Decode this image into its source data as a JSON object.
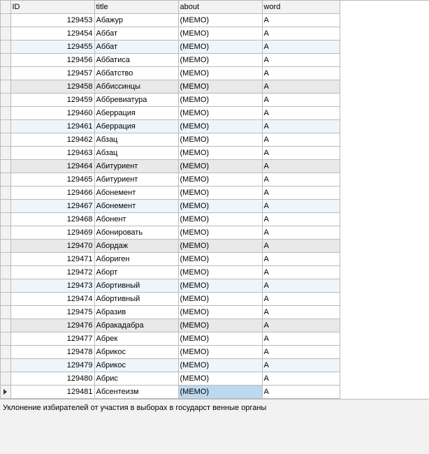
{
  "columns": {
    "id": "ID",
    "title": "title",
    "about": "about",
    "word": "word"
  },
  "rows": [
    {
      "id": "129453",
      "title": "Абажур",
      "about": "(MEMO)",
      "word": "А",
      "hl": ""
    },
    {
      "id": "129454",
      "title": "Аббат",
      "about": "(MEMO)",
      "word": "А",
      "hl": ""
    },
    {
      "id": "129455",
      "title": "Аббат",
      "about": "(MEMO)",
      "word": "А",
      "hl": "lite"
    },
    {
      "id": "129456",
      "title": "Аббатиса",
      "about": "(MEMO)",
      "word": "А",
      "hl": ""
    },
    {
      "id": "129457",
      "title": "Аббатство",
      "about": "(MEMO)",
      "word": "А",
      "hl": ""
    },
    {
      "id": "129458",
      "title": "Аббиссинцы",
      "about": "(MEMO)",
      "word": "А",
      "hl": "dark"
    },
    {
      "id": "129459",
      "title": "Аббревиатура",
      "about": "(MEMO)",
      "word": "А",
      "hl": ""
    },
    {
      "id": "129460",
      "title": "Аберрация",
      "about": "(MEMO)",
      "word": "А",
      "hl": ""
    },
    {
      "id": "129461",
      "title": "Аберрация",
      "about": "(MEMO)",
      "word": "А",
      "hl": "lite"
    },
    {
      "id": "129462",
      "title": "Абзац",
      "about": "(MEMO)",
      "word": "А",
      "hl": ""
    },
    {
      "id": "129463",
      "title": "Абзац",
      "about": "(MEMO)",
      "word": "А",
      "hl": ""
    },
    {
      "id": "129464",
      "title": "Абитуриент",
      "about": "(MEMO)",
      "word": "А",
      "hl": "dark"
    },
    {
      "id": "129465",
      "title": "Абитуриент",
      "about": "(MEMO)",
      "word": "А",
      "hl": ""
    },
    {
      "id": "129466",
      "title": "Абонемент",
      "about": "(MEMO)",
      "word": "А",
      "hl": ""
    },
    {
      "id": "129467",
      "title": "Абонемент",
      "about": "(MEMO)",
      "word": "А",
      "hl": "lite"
    },
    {
      "id": "129468",
      "title": "Абонент",
      "about": "(MEMO)",
      "word": "А",
      "hl": ""
    },
    {
      "id": "129469",
      "title": "Абонировать",
      "about": "(MEMO)",
      "word": "А",
      "hl": ""
    },
    {
      "id": "129470",
      "title": "Абордаж",
      "about": "(MEMO)",
      "word": "А",
      "hl": "dark"
    },
    {
      "id": "129471",
      "title": "Абориген",
      "about": "(MEMO)",
      "word": "А",
      "hl": ""
    },
    {
      "id": "129472",
      "title": "Аборт",
      "about": "(MEMO)",
      "word": "А",
      "hl": ""
    },
    {
      "id": "129473",
      "title": "Абортивный",
      "about": "(MEMO)",
      "word": "А",
      "hl": "lite"
    },
    {
      "id": "129474",
      "title": "Абортивный",
      "about": "(MEMO)",
      "word": "А",
      "hl": ""
    },
    {
      "id": "129475",
      "title": "Абразив",
      "about": "(MEMO)",
      "word": "А",
      "hl": ""
    },
    {
      "id": "129476",
      "title": "Абракадабра",
      "about": "(MEMO)",
      "word": "А",
      "hl": "dark"
    },
    {
      "id": "129477",
      "title": "Абрек",
      "about": "(MEMO)",
      "word": "А",
      "hl": ""
    },
    {
      "id": "129478",
      "title": "Абрикос",
      "about": "(MEMO)",
      "word": "А",
      "hl": ""
    },
    {
      "id": "129479",
      "title": "Абрикос",
      "about": "(MEMO)",
      "word": "А",
      "hl": "lite"
    },
    {
      "id": "129480",
      "title": "Абрис",
      "about": "(MEMO)",
      "word": "А",
      "hl": ""
    },
    {
      "id": "129481",
      "title": "Абсентеизм",
      "about": "(MEMO)",
      "word": "А",
      "hl": "",
      "current": true
    }
  ],
  "selected_cell": {
    "row": 28,
    "col": "about"
  },
  "detail_text": "Уклонение избирателей от участия в выборах в государст венные органы"
}
